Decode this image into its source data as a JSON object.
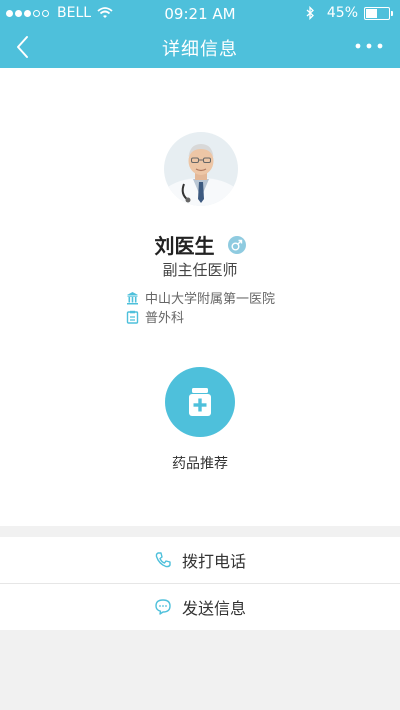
{
  "status_bar": {
    "carrier": "BELL",
    "time": "09:21 AM",
    "battery": "45%",
    "battery_level": 0.45
  },
  "nav": {
    "title": "详细信息",
    "back_icon": "chevron-left-icon",
    "more_icon": "more-icon"
  },
  "doctor": {
    "name": "刘医生",
    "gender_icon": "male-icon",
    "title": "副主任医师",
    "hospital": "中山大学附属第一医院",
    "department": "普外科"
  },
  "medicine": {
    "label": "药品推荐",
    "icon": "medicine-bottle-icon"
  },
  "actions": {
    "call": "拨打电话",
    "message": "发送信息"
  },
  "colors": {
    "accent": "#4ec0db",
    "gender": "#8fcbe0"
  }
}
